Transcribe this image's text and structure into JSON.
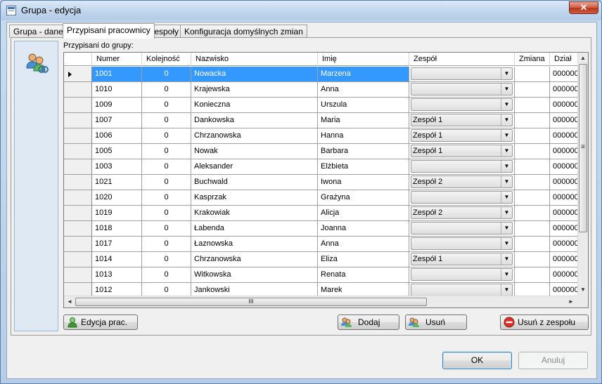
{
  "window": {
    "title": "Grupa - edycja",
    "close_glyph": "✕",
    "icon": "window-app-icon"
  },
  "tabs": [
    {
      "label": "Grupa - dane",
      "active": false
    },
    {
      "label": "Przypisani pracownicy",
      "active": true
    },
    {
      "label": "Zespoły",
      "active": false
    },
    {
      "label": "Konfiguracja domyślnych zmian",
      "active": false
    }
  ],
  "panel": {
    "caption": "Przypisani do grupy:",
    "side_icon": "users-group-icon"
  },
  "grid": {
    "columns": [
      "Numer",
      "Kolejność",
      "Nazwisko",
      "Imię",
      "Zespół",
      "Zmiana",
      "Dział"
    ],
    "rows": [
      {
        "numer": "1001",
        "kolejnosc": "0",
        "nazwisko": "Nowacka",
        "imie": "Marzena",
        "zespol": "",
        "zmiana": "",
        "dzial": "000000",
        "selected": true
      },
      {
        "numer": "1010",
        "kolejnosc": "0",
        "nazwisko": "Krajewska",
        "imie": "Anna",
        "zespol": "",
        "zmiana": "",
        "dzial": "000000"
      },
      {
        "numer": "1009",
        "kolejnosc": "0",
        "nazwisko": "Konieczna",
        "imie": "Urszula",
        "zespol": "",
        "zmiana": "",
        "dzial": "000000"
      },
      {
        "numer": "1007",
        "kolejnosc": "0",
        "nazwisko": "Dankowska",
        "imie": "Maria",
        "zespol": "Zespół 1",
        "zmiana": "",
        "dzial": "000000"
      },
      {
        "numer": "1006",
        "kolejnosc": "0",
        "nazwisko": "Chrzanowska",
        "imie": "Hanna",
        "zespol": "Zespół 1",
        "zmiana": "",
        "dzial": "000000"
      },
      {
        "numer": "1005",
        "kolejnosc": "0",
        "nazwisko": "Nowak",
        "imie": "Barbara",
        "zespol": "Zespół 1",
        "zmiana": "",
        "dzial": "000000"
      },
      {
        "numer": "1003",
        "kolejnosc": "0",
        "nazwisko": "Aleksander",
        "imie": "Elżbieta",
        "zespol": "",
        "zmiana": "",
        "dzial": "000000"
      },
      {
        "numer": "1021",
        "kolejnosc": "0",
        "nazwisko": "Buchwald",
        "imie": "Iwona",
        "zespol": "Zespół 2",
        "zmiana": "",
        "dzial": "000000"
      },
      {
        "numer": "1020",
        "kolejnosc": "0",
        "nazwisko": "Kasprzak",
        "imie": "Grażyna",
        "zespol": "",
        "zmiana": "",
        "dzial": "000000"
      },
      {
        "numer": "1019",
        "kolejnosc": "0",
        "nazwisko": "Krakowiak",
        "imie": "Alicja",
        "zespol": "Zespół 2",
        "zmiana": "",
        "dzial": "000000"
      },
      {
        "numer": "1018",
        "kolejnosc": "0",
        "nazwisko": "Łabenda",
        "imie": "Joanna",
        "zespol": "",
        "zmiana": "",
        "dzial": "000000"
      },
      {
        "numer": "1017",
        "kolejnosc": "0",
        "nazwisko": "Łaznowska",
        "imie": "Anna",
        "zespol": "",
        "zmiana": "",
        "dzial": "000000"
      },
      {
        "numer": "1014",
        "kolejnosc": "0",
        "nazwisko": "Chrzanowska",
        "imie": "Eliza",
        "zespol": "Zespół 1",
        "zmiana": "",
        "dzial": "000000"
      },
      {
        "numer": "1013",
        "kolejnosc": "0",
        "nazwisko": "Witkowska",
        "imie": "Renata",
        "zespol": "",
        "zmiana": "",
        "dzial": "000000"
      },
      {
        "numer": "1012",
        "kolejnosc": "0",
        "nazwisko": "Jankowski",
        "imie": "Marek",
        "zespol": "",
        "zmiana": "",
        "dzial": "000000"
      }
    ],
    "scroll": {
      "up": "▲",
      "down": "▼",
      "left": "◄",
      "right": "►",
      "grip_v": "≡",
      "grip_h": "III",
      "combo_arrow": "▼"
    }
  },
  "buttons": {
    "edycja": {
      "label": "Edycja prac.",
      "icon": "user-edit-icon"
    },
    "dodaj": {
      "label": "Dodaj",
      "icon": "users-add-icon"
    },
    "usun": {
      "label": "Usuń",
      "icon": "users-remove-icon"
    },
    "usun_z_zespolu": {
      "label": "Usuń z zespołu",
      "icon": "remove-red-icon"
    },
    "ok": {
      "label": "OK"
    },
    "anuluj": {
      "label": "Anuluj"
    }
  },
  "colors": {
    "selection": "#3399ff",
    "remove_red": "#d9302a",
    "green": "#3f9a2e"
  }
}
